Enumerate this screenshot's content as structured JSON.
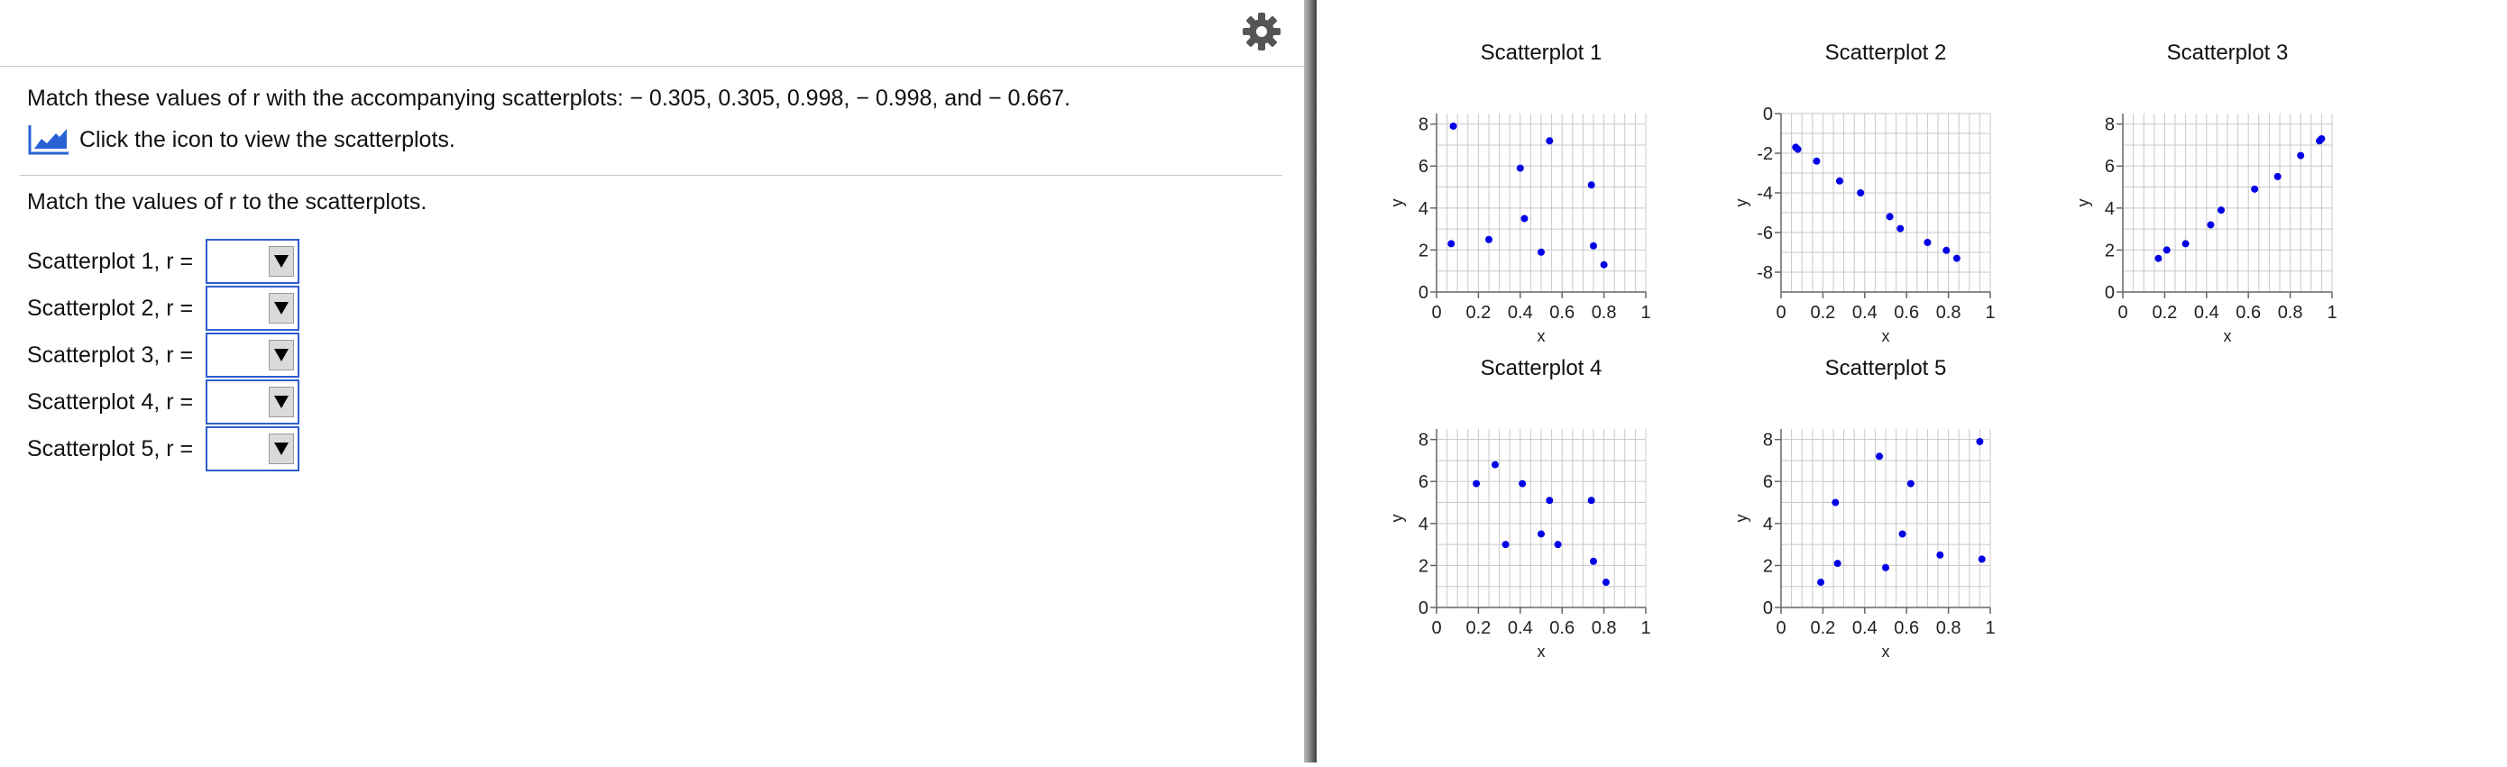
{
  "question": {
    "prompt": "Match these values of r with the accompanying scatterplots:  − 0.305, 0.305, 0.998,  − 0.998, and  − 0.667.",
    "hint_text": "Click the icon to view the scatterplots.",
    "instruction": "Match the values of r to the scatterplots."
  },
  "answers": [
    {
      "label": "Scatterplot 1, r =",
      "value": ""
    },
    {
      "label": "Scatterplot 2, r =",
      "value": ""
    },
    {
      "label": "Scatterplot 3, r =",
      "value": ""
    },
    {
      "label": "Scatterplot 4, r =",
      "value": ""
    },
    {
      "label": "Scatterplot 5, r =",
      "value": ""
    }
  ],
  "icons": {
    "settings": "gear-icon",
    "chart_link": "line-chart-icon",
    "dropdown": "triangle-down-icon"
  },
  "colors": {
    "point": "#0000e6",
    "dropdown_border": "#2f5fd0",
    "grid": "#c8c8c8"
  },
  "chart_data": [
    {
      "type": "scatter",
      "title": "Scatterplot 1",
      "xlabel": "x",
      "ylabel": "y",
      "xlim": [
        0,
        1
      ],
      "ylim": [
        0,
        8.5
      ],
      "xticks": [
        "0",
        "0.2",
        "0.4",
        "0.6",
        "0.8",
        "1"
      ],
      "yticks": [
        "0",
        "2",
        "4",
        "6",
        "8"
      ],
      "grid": true,
      "points": [
        [
          0.07,
          2.3
        ],
        [
          0.08,
          7.9
        ],
        [
          0.25,
          2.5
        ],
        [
          0.4,
          5.9
        ],
        [
          0.42,
          3.5
        ],
        [
          0.5,
          1.9
        ],
        [
          0.54,
          7.2
        ],
        [
          0.74,
          5.1
        ],
        [
          0.75,
          2.2
        ],
        [
          0.8,
          1.3
        ]
      ]
    },
    {
      "type": "scatter",
      "title": "Scatterplot 2",
      "xlabel": "x",
      "ylabel": "y",
      "xlim": [
        0,
        1
      ],
      "ylim": [
        -9,
        0
      ],
      "xticks": [
        "0",
        "0.2",
        "0.4",
        "0.6",
        "0.8",
        "1"
      ],
      "yticks": [
        "0",
        "-2",
        "-4",
        "-6",
        "-8"
      ],
      "grid": true,
      "points": [
        [
          0.07,
          -1.7
        ],
        [
          0.08,
          -1.8
        ],
        [
          0.17,
          -2.4
        ],
        [
          0.28,
          -3.4
        ],
        [
          0.38,
          -4.0
        ],
        [
          0.52,
          -5.2
        ],
        [
          0.57,
          -5.8
        ],
        [
          0.7,
          -6.5
        ],
        [
          0.79,
          -6.9
        ],
        [
          0.84,
          -7.3
        ]
      ]
    },
    {
      "type": "scatter",
      "title": "Scatterplot 3",
      "xlabel": "x",
      "ylabel": "y",
      "xlim": [
        0,
        1
      ],
      "ylim": [
        0,
        8.5
      ],
      "xticks": [
        "0",
        "0.2",
        "0.4",
        "0.6",
        "0.8",
        "1"
      ],
      "yticks": [
        "0",
        "2",
        "4",
        "6",
        "8"
      ],
      "grid": true,
      "points": [
        [
          0.17,
          1.6
        ],
        [
          0.21,
          2.0
        ],
        [
          0.3,
          2.3
        ],
        [
          0.42,
          3.2
        ],
        [
          0.47,
          3.9
        ],
        [
          0.63,
          4.9
        ],
        [
          0.74,
          5.5
        ],
        [
          0.85,
          6.5
        ],
        [
          0.94,
          7.2
        ],
        [
          0.95,
          7.3
        ]
      ]
    },
    {
      "type": "scatter",
      "title": "Scatterplot 4",
      "xlabel": "x",
      "ylabel": "y",
      "xlim": [
        0,
        1
      ],
      "ylim": [
        0,
        8.5
      ],
      "xticks": [
        "0",
        "0.2",
        "0.4",
        "0.6",
        "0.8",
        "1"
      ],
      "yticks": [
        "0",
        "2",
        "4",
        "6",
        "8"
      ],
      "grid": true,
      "points": [
        [
          0.19,
          5.9
        ],
        [
          0.28,
          6.8
        ],
        [
          0.33,
          3.0
        ],
        [
          0.41,
          5.9
        ],
        [
          0.5,
          3.5
        ],
        [
          0.54,
          5.1
        ],
        [
          0.58,
          3.0
        ],
        [
          0.74,
          5.1
        ],
        [
          0.75,
          2.2
        ],
        [
          0.81,
          1.2
        ]
      ]
    },
    {
      "type": "scatter",
      "title": "Scatterplot 5",
      "xlabel": "x",
      "ylabel": "y",
      "xlim": [
        0,
        1
      ],
      "ylim": [
        0,
        8.5
      ],
      "xticks": [
        "0",
        "0.2",
        "0.4",
        "0.6",
        "0.8",
        "1"
      ],
      "yticks": [
        "0",
        "2",
        "4",
        "6",
        "8"
      ],
      "grid": true,
      "points": [
        [
          0.19,
          1.2
        ],
        [
          0.26,
          5.0
        ],
        [
          0.27,
          2.1
        ],
        [
          0.47,
          7.2
        ],
        [
          0.5,
          1.9
        ],
        [
          0.58,
          3.5
        ],
        [
          0.62,
          5.9
        ],
        [
          0.76,
          2.5
        ],
        [
          0.95,
          7.9
        ],
        [
          0.96,
          2.3
        ]
      ]
    }
  ]
}
